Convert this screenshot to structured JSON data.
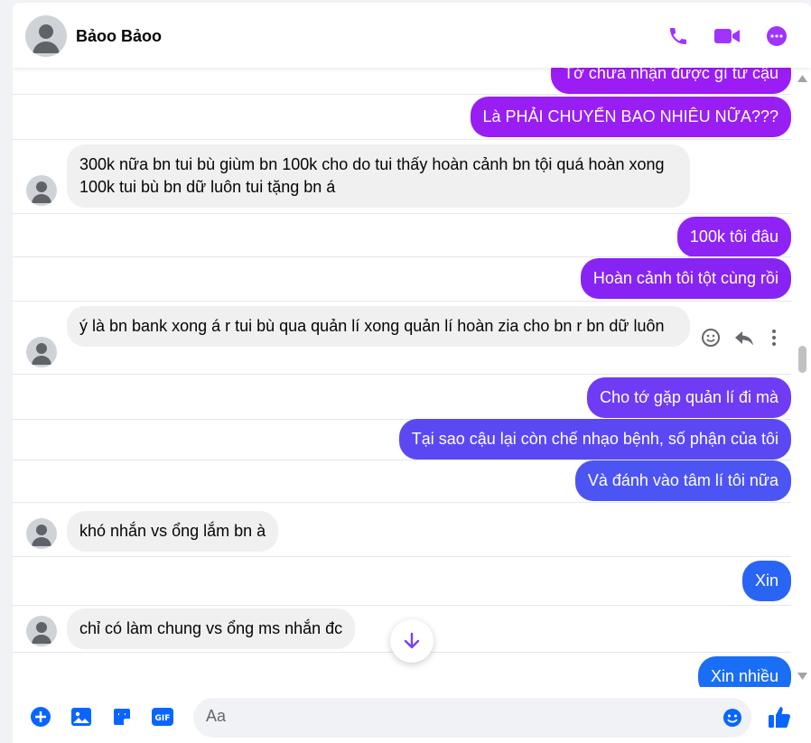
{
  "contact": {
    "name": "Bảoo Bảoo"
  },
  "icons": {
    "call": "phone-icon",
    "video": "video-camera-icon",
    "more": "more-options-icon"
  },
  "colors": {
    "accent": "#a033ff",
    "accent_blue": "#0866ff",
    "purple_grad_top": "#9b1cf5",
    "blue_grad_bottom": "#1c6cf5",
    "incoming_bg": "#f0f0f0"
  },
  "messages": [
    {
      "dir": "out",
      "text": "Tớ chưa nhận được gì từ cậu"
    },
    {
      "dir": "out",
      "text": "Là PHẢI CHUYỂN BAO NHIÊU NỮA???"
    },
    {
      "dir": "in",
      "text": "300k nữa bn tui bù giùm bn 100k cho do tui thấy hoàn cảnh bn tội quá hoàn xong 100k tui bù bn dữ luôn tui tặng bn á"
    },
    {
      "dir": "out",
      "text": "100k tôi đâu"
    },
    {
      "dir": "out",
      "text": "Hoàn cảnh tôi tột cùng rồi"
    },
    {
      "dir": "in",
      "text": "ý là bn bank xong á r tui bù qua quản lí xong quản lí hoàn zia cho bn r bn dữ luôn"
    },
    {
      "dir": "out",
      "text": "Cho tớ gặp quản lí đi mà"
    },
    {
      "dir": "out",
      "text": "Tại sao cậu lại còn chế nhạo bệnh, số phận của tôi"
    },
    {
      "dir": "out",
      "text": "Và đánh vào tâm lí tôi nữa"
    },
    {
      "dir": "in",
      "text": "khó nhắn vs ổng lắm bn à"
    },
    {
      "dir": "out",
      "text": "Xin"
    },
    {
      "dir": "in",
      "text": "chỉ có làm chung vs ổng ms nhắn đc"
    },
    {
      "dir": "out",
      "text": "Xin nhiều"
    }
  ],
  "composer": {
    "placeholder": "Aa"
  }
}
